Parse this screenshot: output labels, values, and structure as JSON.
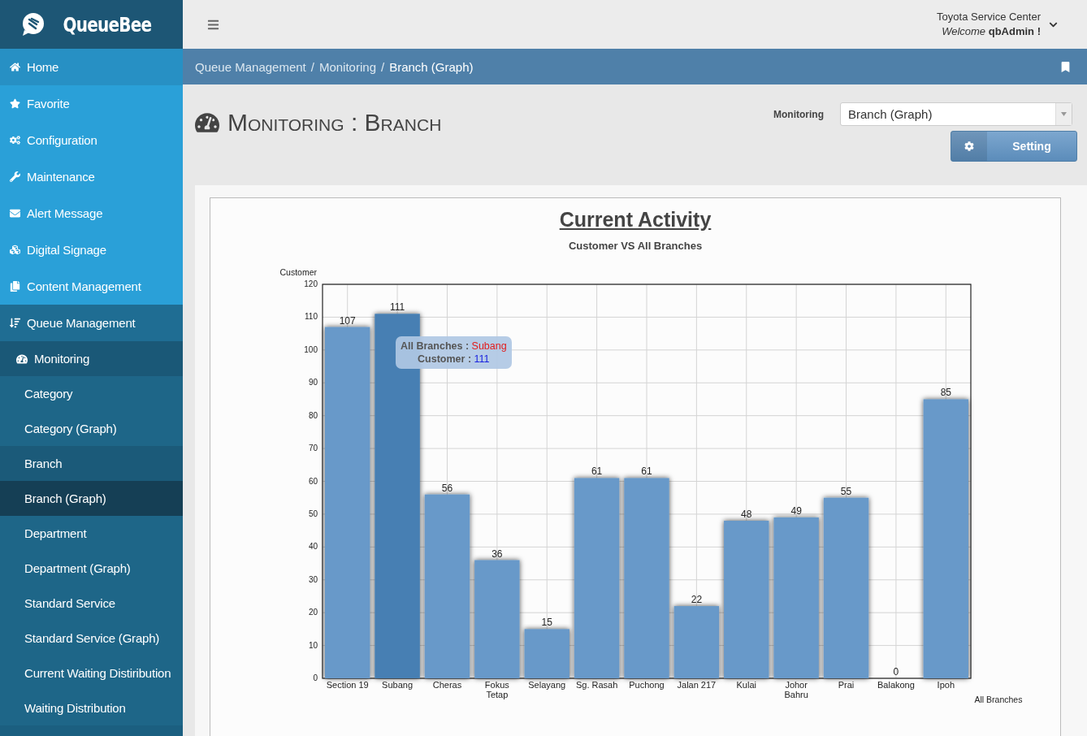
{
  "brand": {
    "name": "QueueBee"
  },
  "header": {
    "organization": "Toyota Service Center",
    "welcome": "*Welcome* **qbAdmin !**"
  },
  "sidebar": {
    "items": [
      {
        "label": "Home",
        "selected": false
      },
      {
        "label": "Favorite",
        "selected": false
      },
      {
        "label": "Configuration",
        "selected": false
      },
      {
        "label": "Maintenance",
        "selected": false
      },
      {
        "label": "Alert Message",
        "selected": false
      },
      {
        "label": "Digital Signage",
        "selected": false
      },
      {
        "label": "Content Management",
        "selected": false
      },
      {
        "label": "Queue Management",
        "selected": false,
        "expanded": true,
        "children": [
          {
            "label": "Monitoring",
            "selected": false,
            "expanded": true,
            "children": [
              {
                "label": "Category",
                "selected": false
              },
              {
                "label": "Category (Graph)",
                "selected": false
              },
              {
                "label": "Branch",
                "selected": false
              },
              {
                "label": "Branch (Graph)",
                "selected": true
              },
              {
                "label": "Department",
                "selected": false
              },
              {
                "label": "Department (Graph)",
                "selected": false
              },
              {
                "label": "Standard Service",
                "selected": false
              },
              {
                "label": "Standard Service (Graph)",
                "selected": false
              },
              {
                "label": "Current Waiting Distiribution",
                "selected": false
              },
              {
                "label": "Waiting Distribution",
                "selected": false
              }
            ]
          }
        ]
      }
    ]
  },
  "breadcrumb": [
    {
      "label": "Queue Management",
      "separator": "/"
    },
    {
      "label": "Monitoring",
      "separator": "/"
    },
    {
      "label": "Branch (Graph)"
    }
  ],
  "page": {
    "title": "Monitoring : Branch",
    "filter_label": "Monitoring",
    "filter_value": "Branch (Graph)",
    "setting_button": "Setting"
  },
  "chart": {
    "title": "Current Activity",
    "subtitle": "Customer VS All Branches",
    "bars": [
      {
        "selected": false
      },
      {
        "selected": true
      },
      {
        "selected": false
      },
      {
        "selected": false
      },
      {
        "selected": false
      },
      {
        "selected": false
      },
      {
        "selected": false
      },
      {
        "selected": false
      },
      {
        "selected": false
      },
      {
        "selected": false
      },
      {
        "selected": false
      },
      {
        "selected": false
      },
      {
        "selected": false
      }
    ],
    "tooltip": {
      "separators": [
        ":",
        ":"
      ],
      "category": "Subang",
      "value": "111"
    },
    "chart_data": {
      "type": "bar",
      "xlabel": "All Branches",
      "ylabel": "Customer",
      "categories": [
        "Section 19",
        "Subang",
        "Cheras",
        "Fokus Tetap",
        "Selayang",
        "Sg. Rasah",
        "Puchong",
        "Jalan 217",
        "Kulai",
        "Johor Bahru",
        "Prai",
        "Balakong",
        "Ipoh"
      ],
      "series": [
        {
          "name": "Customer",
          "color": "#6899c9",
          "values": [
            107,
            111,
            56,
            36,
            15,
            61,
            61,
            22,
            48,
            49,
            55,
            0,
            85
          ]
        }
      ],
      "grid": true,
      "ylim": [
        0,
        120
      ],
      "yticks": [
        0,
        10,
        20,
        30,
        40,
        50,
        60,
        70,
        80,
        90,
        100,
        110,
        120
      ],
      "data_labels": true
    }
  }
}
